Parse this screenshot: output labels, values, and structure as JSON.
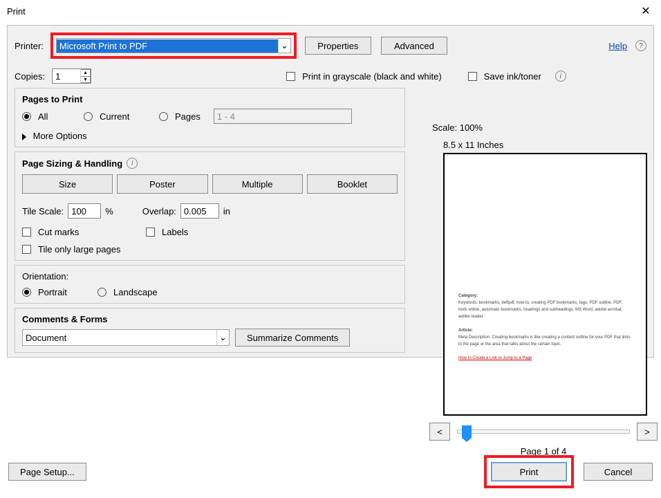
{
  "window": {
    "title": "Print"
  },
  "top": {
    "printer_label": "Printer:",
    "printer_value": "Microsoft Print to PDF",
    "properties_label": "Properties",
    "advanced_label": "Advanced",
    "help_label": "Help"
  },
  "copies": {
    "label": "Copies:",
    "value": "1",
    "grayscale_label": "Print in grayscale (black and white)",
    "saveink_label": "Save ink/toner"
  },
  "pages": {
    "title": "Pages to Print",
    "all": "All",
    "current": "Current",
    "pages": "Pages",
    "range_placeholder": "1 - 4",
    "more_options": "More Options"
  },
  "sizing": {
    "title": "Page Sizing & Handling",
    "size": "Size",
    "poster": "Poster",
    "multiple": "Multiple",
    "booklet": "Booklet",
    "tilescale_label": "Tile Scale:",
    "tilescale_value": "100",
    "percent": "%",
    "overlap_label": "Overlap:",
    "overlap_value": "0.005",
    "overlap_unit": "in",
    "cutmarks": "Cut marks",
    "labels_cb": "Labels",
    "tile_only": "Tile only large pages"
  },
  "orientation": {
    "title": "Orientation:",
    "portrait": "Portrait",
    "landscape": "Landscape"
  },
  "comments": {
    "title": "Comments & Forms",
    "value": "Document",
    "summarize": "Summarize Comments"
  },
  "preview": {
    "scale_label": "Scale: 100%",
    "pagesize": "8.5 x 11 Inches",
    "prev": "<",
    "next": ">",
    "page_of": "Page 1 of 4",
    "doc_category": "Category:",
    "doc_keywords": "Keywords: bookmarks, deftpdf, how-to, creating PDF bookmarks, tags, PDF outline, PDF, tools online, automatic bookmarks, headings and subheadings, MS Word, adobe acrobat, adobe reader",
    "doc_article": "Article:",
    "doc_meta": "Meta Description: Creating bookmarks is like creating a content outline for your PDF that links to the page or the area that talks about the certain topic.",
    "doc_link": "How to Create a Link to Jump to a Page"
  },
  "footer": {
    "pagesetup": "Page Setup...",
    "print": "Print",
    "cancel": "Cancel"
  }
}
